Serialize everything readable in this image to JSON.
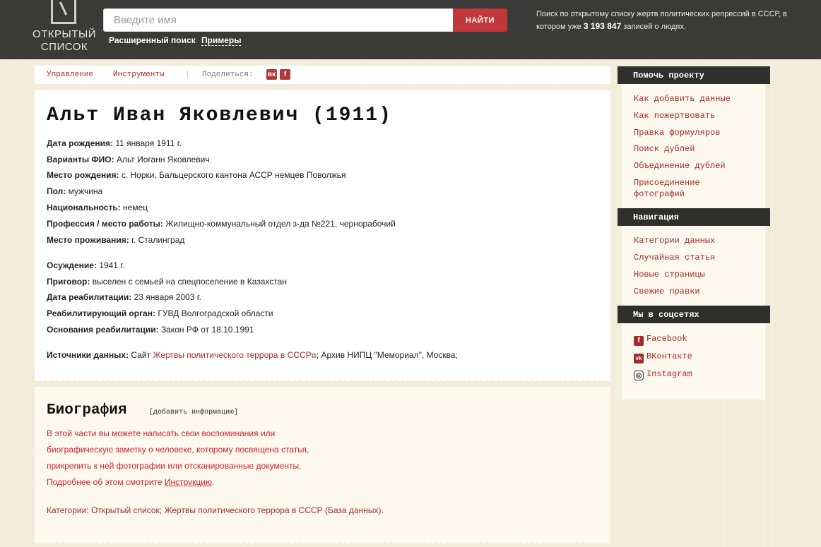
{
  "header": {
    "logo_line1": "ОТКРЫТЫЙ",
    "logo_line2": "СПИСОК",
    "search_placeholder": "Введите имя",
    "search_button": "НАЙТИ",
    "advanced_search": "Расширенный поиск",
    "examples": "Примеры",
    "info_prefix": "Поиск по открытому списку жертв политических репрессий в СССР, в котором уже",
    "info_count": "3 193 847",
    "info_suffix": "записей о людях."
  },
  "toolbar": {
    "manage": "Управление",
    "tools": "Инструменты",
    "separator": "|",
    "share": "Поделиться:",
    "vk": "вк",
    "fb": "f"
  },
  "person": {
    "title": "Альт Иван Яковлевич (1911)",
    "fields": [
      {
        "label": "Дата рождения:",
        "value": "11 января 1911 г."
      },
      {
        "label": "Варианты ФИО:",
        "value": "Альт Иоганн Яковлевич"
      },
      {
        "label": "Место рождения:",
        "value": "с. Норки, Бальцерского кантона АССР немцев Поволжья"
      },
      {
        "label": "Пол:",
        "value": "мужчина"
      },
      {
        "label": "Национальность:",
        "value": "немец"
      },
      {
        "label": "Профессия / место работы:",
        "value": "Жилищно-коммунальный отдел з-да №221, чернорабочий"
      },
      {
        "label": "Место проживания:",
        "value": "г. Сталинград"
      },
      {
        "label": "Осуждение:",
        "value": "1941 г."
      },
      {
        "label": "Приговор:",
        "value": "выселен с семьей на спецпоселение в Казахстан"
      },
      {
        "label": "Дата реабилитации:",
        "value": "23 января 2003 г."
      },
      {
        "label": "Реабилитирующий орган:",
        "value": "ГУВД Волгоградской области"
      },
      {
        "label": "Основания реабилитации:",
        "value": "Закон РФ от 18.10.1991"
      }
    ],
    "sources_label": "Источники данных:",
    "sources_site": "Сайт",
    "sources_link": "Жертвы политического террора в СССР",
    "sources_rest": "; Архив НИПЦ \"Мемориал\", Москва;"
  },
  "bio": {
    "title": "Биография",
    "add_info": "[добавить информацию]",
    "line1": "В этой части вы можете написать свои воспоминания или",
    "line2": "биографическую заметку о человеке, которому посвящена статья,",
    "line3": "прикрепить к ней фотографии или отсканированные документы.",
    "line4_prefix": "Подробнее об этом смотрите",
    "line4_link": "Инструкцию",
    "line4_suffix": ".",
    "categories_label": "Категории:",
    "categories_value": "Открытый список; Жертвы политического террора в СССР (База данных)."
  },
  "sidebar": {
    "help_title": "Помочь проекту",
    "help_links": [
      "Как добавить данные",
      "Как пожертвовать",
      "Правка формуляров",
      "Поиск дублей",
      "Объединение дублей",
      "Присоединение",
      "фотографий"
    ],
    "nav_title": "Навигация",
    "nav_links": [
      "Категории данных",
      "Случайная статья",
      "Новые страницы",
      "Свежие правки"
    ],
    "social_title": "Мы в соцсетях",
    "social_links": [
      "Facebook",
      "ВКонтакте",
      "Instagram"
    ],
    "social_icons": [
      "f",
      "vk",
      "◎"
    ]
  },
  "colors": {
    "accent": "#a52a2a",
    "button": "#c0383a",
    "header_bg": "#3a3a38",
    "bio_text": "#d3222a"
  }
}
